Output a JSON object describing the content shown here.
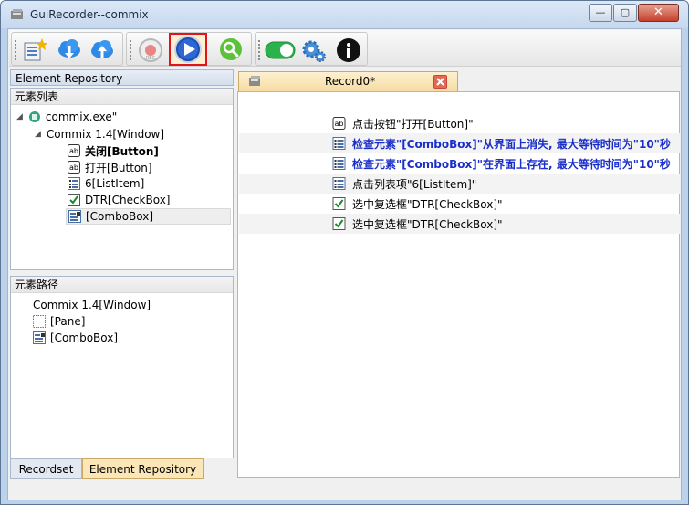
{
  "window": {
    "title": "GuiRecorder--commix",
    "min_glyph": "—",
    "max_glyph": "▢",
    "close_glyph": "✕"
  },
  "toolbar": {
    "buttons": [
      {
        "name": "new-project-icon"
      },
      {
        "name": "download-cloud-icon"
      },
      {
        "name": "upload-cloud-icon"
      },
      {
        "name": "record-icon"
      },
      {
        "name": "play-icon",
        "selected": true
      },
      {
        "name": "search-element-icon"
      },
      {
        "name": "toggle-switch-icon"
      },
      {
        "name": "settings-gear-icon"
      },
      {
        "name": "info-icon"
      }
    ]
  },
  "element_repository": {
    "title": "Element Repository",
    "list_header": "元素列表",
    "tree": [
      {
        "label": "commix.exe\"",
        "icon": "app-icon",
        "depth": 0
      },
      {
        "label": "Commix 1.4[Window]",
        "icon": "",
        "depth": 1
      },
      {
        "label": "关闭[Button]",
        "icon": "button-ab-icon",
        "depth": 2,
        "bold": true
      },
      {
        "label": "打开[Button]",
        "icon": "button-ab-icon",
        "depth": 2
      },
      {
        "label": "6[ListItem]",
        "icon": "listitem-icon",
        "depth": 2
      },
      {
        "label": "DTR[CheckBox]",
        "icon": "checkbox-icon",
        "depth": 2
      },
      {
        "label": "[ComboBox]",
        "icon": "combobox-icon",
        "depth": 2,
        "selected": true
      }
    ],
    "path_header": "元素路径",
    "path": [
      {
        "label": "Commix 1.4[Window]",
        "icon": ""
      },
      {
        "label": "[Pane]",
        "icon": "pane-icon"
      },
      {
        "label": "[ComboBox]",
        "icon": "combobox-icon"
      }
    ]
  },
  "bottom_tabs": [
    {
      "label": "Recordset",
      "active": false
    },
    {
      "label": "Element Repository",
      "active": true
    }
  ],
  "record": {
    "tab_label": "Record0*",
    "steps": [
      {
        "text": "点击按钮\"打开[Button]\"",
        "icon": "button-ab-icon",
        "blue": false
      },
      {
        "text": "检查元素\"[ComboBox]\"从界面上消失, 最大等待时间为\"10\"秒",
        "icon": "check-element-icon",
        "blue": true
      },
      {
        "text": "检查元素\"[ComboBox]\"在界面上存在, 最大等待时间为\"10\"秒",
        "icon": "check-element-icon",
        "blue": true
      },
      {
        "text": "点击列表项\"6[ListItem]\"",
        "icon": "listitem-icon",
        "blue": false
      },
      {
        "text": "选中复选框\"DTR[CheckBox]\"",
        "icon": "checkbox-icon",
        "blue": false
      },
      {
        "text": "选中复选框\"DTR[CheckBox]\"",
        "icon": "checkbox-icon",
        "blue": false
      }
    ]
  },
  "colors": {
    "accent_blue": "#1a2ec9",
    "selected_border": "#e0141a",
    "tab_active": "#fbe6b8"
  }
}
